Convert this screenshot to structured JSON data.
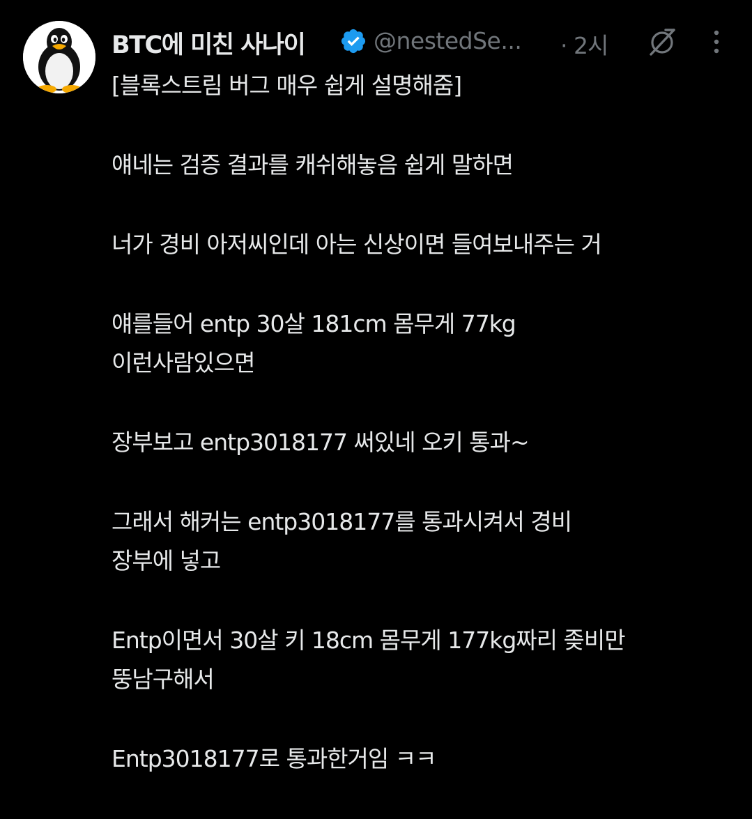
{
  "author": {
    "display_name": "BTC에 미친 사나이",
    "handle": "@nestedSe...",
    "time": "· 2시",
    "avatar_icon": "linux-penguin-icon",
    "verified_icon": "verified-badge-icon",
    "verified_color": "#1d9bf0"
  },
  "actions": {
    "grok_icon": "grok-icon",
    "more_icon": "more-vertical-icon"
  },
  "tweet": {
    "paragraphs": [
      "[블록스트림 버그 매우 쉽게 설명해줌]",
      "얘네는 검증 결과를 캐쉬해놓음 쉽게 말하면",
      "너가 경비 아저씨인데 아는 신상이면 들여보내주는 거",
      "얘를들어 entp 30살 181cm 몸무게 77kg\n이런사람있으면",
      "장부보고 entp3018177 써있네 오키 통과~",
      "그래서 해커는 entp3018177를 통과시켜서 경비\n장부에 넣고",
      "Entp이면서 30살 키 18cm 몸무게 177kg짜리 좆비만\n뚱남구해서",
      "Entp3018177로 통과한거임 ㅋㅋ"
    ]
  },
  "colors": {
    "background": "#000000",
    "text_primary": "#e7e9ea",
    "text_secondary": "#71767b"
  }
}
